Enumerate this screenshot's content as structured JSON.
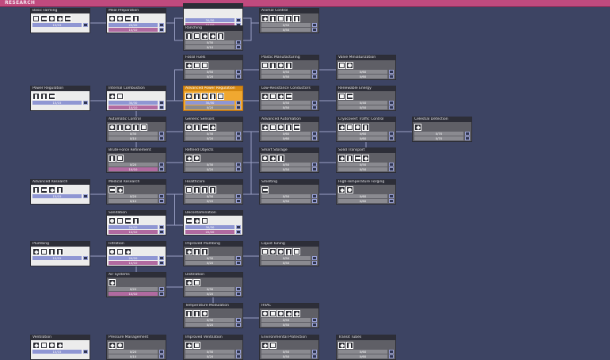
{
  "window": {
    "title": "RESEARCH"
  },
  "colors": {
    "background": "#3d4463",
    "header": "#c04a7e",
    "bar_primary": "#8f96d3",
    "bar_secondary": "#b16aa0",
    "active": "#f0a830"
  },
  "nodes": [
    {
      "name": "Basic Farming",
      "col": 0,
      "row": 0,
      "state": "done",
      "icons": [
        "plant",
        "planter",
        "oven",
        "cooker",
        "flag"
      ],
      "bars": [
        {
          "text": "15/15",
          "fill": 1
        }
      ]
    },
    {
      "name": "Meal Preparation",
      "col": 1,
      "row": 0,
      "state": "done",
      "icons": [
        "cooker",
        "grill",
        "fridge",
        "sink"
      ],
      "bars": [
        {
          "text": "20/20",
          "fill": 1
        },
        {
          "text": "10/10",
          "fill": 1
        }
      ]
    },
    {
      "name": "",
      "col": 2,
      "row": -0.15,
      "state": "done",
      "icons": [],
      "bars": [
        {
          "text": "30/30",
          "fill": 1
        },
        {
          "text": "10/10",
          "fill": 1
        }
      ]
    },
    {
      "name": "Animal Control",
      "col": 3,
      "row": 0,
      "state": "locked",
      "icons": [
        "trap",
        "feeder",
        "fishtrap",
        "incubator",
        "egg"
      ],
      "bars": [
        {
          "text": "0/50",
          "fill": 0
        },
        {
          "text": "0/50",
          "fill": 0
        }
      ]
    },
    {
      "name": "Ranching",
      "col": 2,
      "row": 0.55,
      "state": "locked",
      "icons": [
        "station",
        "drop",
        "barrier",
        "stable",
        "grooming"
      ],
      "bars": [
        {
          "text": "0/30",
          "fill": 0
        },
        {
          "text": "0/10",
          "fill": 0
        }
      ]
    },
    {
      "name": "Fossil Fuels",
      "col": 2,
      "row": 1.5,
      "state": "locked",
      "icons": [
        "generator",
        "pump",
        "refinery"
      ],
      "bars": [
        {
          "text": "0/50",
          "fill": 0
        },
        {
          "text": "0/20",
          "fill": 0
        }
      ]
    },
    {
      "name": "Plastic Manufacturing",
      "col": 3,
      "row": 1.5,
      "state": "locked",
      "icons": [
        "press",
        "loader",
        "pump",
        "vent"
      ],
      "bars": [
        {
          "text": "0/50",
          "fill": 0
        },
        {
          "text": "0/50",
          "fill": 0
        }
      ]
    },
    {
      "name": "Valve Miniaturization",
      "col": 4,
      "row": 1.5,
      "state": "locked",
      "icons": [
        "valve",
        "valve"
      ],
      "bars": [
        {
          "text": "0/60",
          "fill": 0
        },
        {
          "text": "0/60",
          "fill": 0
        }
      ]
    },
    {
      "name": "Power Regulation",
      "col": 0,
      "row": 2.5,
      "state": "done",
      "icons": [
        "battery",
        "transformer",
        "switch"
      ],
      "bars": [
        {
          "text": "15/15",
          "fill": 1
        }
      ]
    },
    {
      "name": "Internal Combustion",
      "col": 1,
      "row": 2.5,
      "state": "done",
      "icons": [
        "generator",
        "wire"
      ],
      "bars": [
        {
          "text": "30/30",
          "fill": 1
        },
        {
          "text": "10/10",
          "fill": 1
        }
      ]
    },
    {
      "name": "Advanced Power Regulation",
      "col": 2,
      "row": 2.5,
      "state": "active",
      "icons": [
        "transformer",
        "switch",
        "wire",
        "wire",
        "bridge"
      ],
      "bars": [
        {
          "text": "30/30",
          "fill": 1
        },
        {
          "text": "0/20",
          "fill": 0
        }
      ]
    },
    {
      "name": "Low-Resistance Conductors",
      "col": 3,
      "row": 2.5,
      "state": "locked",
      "icons": [
        "conductor",
        "wire",
        "battery",
        "joint"
      ],
      "bars": [
        {
          "text": "0/50",
          "fill": 0
        },
        {
          "text": "0/50",
          "fill": 0
        }
      ]
    },
    {
      "name": "Renewable Energy",
      "col": 4,
      "row": 2.5,
      "state": "locked",
      "icons": [
        "solar",
        "turbine"
      ],
      "bars": [
        {
          "text": "0/40",
          "fill": 0
        },
        {
          "text": "0/50",
          "fill": 0
        }
      ]
    },
    {
      "name": "Automatic Control",
      "col": 1,
      "row": 3.5,
      "state": "locked",
      "icons": [
        "sensor",
        "sensor",
        "gate",
        "gate",
        "motion"
      ],
      "bars": [
        {
          "text": "0/30",
          "fill": 0
        },
        {
          "text": "0/10",
          "fill": 0
        }
      ]
    },
    {
      "name": "Generic Sensors",
      "col": 2,
      "row": 3.5,
      "state": "locked",
      "icons": [
        "sensor",
        "sensor",
        "sensor",
        "sensor"
      ],
      "bars": [
        {
          "text": "0/30",
          "fill": 0
        },
        {
          "text": "0/20",
          "fill": 0
        }
      ]
    },
    {
      "name": "Advanced Automation",
      "col": 3,
      "row": 3.5,
      "state": "locked",
      "icons": [
        "gate",
        "gate",
        "gate",
        "gate",
        "gate"
      ],
      "bars": [
        {
          "text": "0/60",
          "fill": 0
        },
        {
          "text": "0/60",
          "fill": 0
        }
      ]
    },
    {
      "name": "Cryocovert Traffic Control",
      "col": 4,
      "row": 3.5,
      "state": "locked",
      "icons": [
        "rail",
        "rail",
        "rail",
        "rail"
      ],
      "bars": [
        {
          "text": "0/60",
          "fill": 0
        },
        {
          "text": "0/60",
          "fill": 0
        }
      ]
    },
    {
      "name": "Celestial Detection",
      "col": 5,
      "row": 3.5,
      "state": "locked",
      "icons": [
        "telescope"
      ],
      "bars": [
        {
          "text": "0/70",
          "fill": 0
        },
        {
          "text": "0/70",
          "fill": 0
        }
      ]
    },
    {
      "name": "Brute-Force Refinement",
      "col": 1,
      "row": 4.5,
      "state": "locked",
      "icons": [
        "crusher",
        "kiln"
      ],
      "bars": [
        {
          "text": "0/20",
          "fill": 0
        },
        {
          "text": "10/10",
          "fill": 1
        }
      ]
    },
    {
      "name": "Refined Objects",
      "col": 2,
      "row": 4.5,
      "state": "locked",
      "icons": [
        "door",
        "press"
      ],
      "bars": [
        {
          "text": "0/30",
          "fill": 0
        },
        {
          "text": "0/20",
          "fill": 0
        }
      ]
    },
    {
      "name": "Smart Storage",
      "col": 3,
      "row": 4.5,
      "state": "locked",
      "icons": [
        "locker",
        "bin",
        "shelf"
      ],
      "bars": [
        {
          "text": "0/50",
          "fill": 0
        },
        {
          "text": "0/50",
          "fill": 0
        }
      ]
    },
    {
      "name": "Solid Transport",
      "col": 4,
      "row": 4.5,
      "state": "locked",
      "icons": [
        "rail",
        "loader",
        "bridge",
        "sensor"
      ],
      "bars": [
        {
          "text": "0/50",
          "fill": 0
        },
        {
          "text": "0/50",
          "fill": 0
        }
      ]
    },
    {
      "name": "Advanced Research",
      "col": 0,
      "row": 5.5,
      "state": "done",
      "icons": [
        "station",
        "station",
        "station",
        "gear"
      ],
      "bars": [
        {
          "text": "15/15",
          "fill": 1
        }
      ]
    },
    {
      "name": "Medical Research",
      "col": 1,
      "row": 5.5,
      "state": "locked",
      "icons": [
        "bed",
        "cot"
      ],
      "bars": [
        {
          "text": "0/20",
          "fill": 0
        },
        {
          "text": "0/10",
          "fill": 0
        }
      ]
    },
    {
      "name": "Healthcare",
      "col": 2,
      "row": 5.5,
      "state": "locked",
      "icons": [
        "apothecary",
        "clinic",
        "cross",
        "pump"
      ],
      "bars": [
        {
          "text": "0/30",
          "fill": 0
        },
        {
          "text": "0/20",
          "fill": 0
        }
      ]
    },
    {
      "name": "Smelting",
      "col": 3,
      "row": 5.5,
      "state": "locked",
      "icons": [
        "refinery"
      ],
      "bars": [
        {
          "text": "0/50",
          "fill": 0
        },
        {
          "text": "0/50",
          "fill": 0
        }
      ]
    },
    {
      "name": "High-Temperature Forging",
      "col": 4,
      "row": 5.5,
      "state": "locked",
      "icons": [
        "kiln",
        "press"
      ],
      "bars": [
        {
          "text": "0/60",
          "fill": 0
        },
        {
          "text": "0/60",
          "fill": 0
        }
      ]
    },
    {
      "name": "Sanitation",
      "col": 1,
      "row": 6.5,
      "state": "done",
      "icons": [
        "toilet",
        "sink",
        "shower",
        "wash"
      ],
      "bars": [
        {
          "text": "20/20",
          "fill": 1
        },
        {
          "text": "10/10",
          "fill": 1
        }
      ]
    },
    {
      "name": "Decontamination",
      "col": 2,
      "row": 6.5,
      "state": "done",
      "icons": [
        "scrubber",
        "scrubber",
        "purifier"
      ],
      "bars": [
        {
          "text": "30/30",
          "fill": 1
        },
        {
          "text": "20/20",
          "fill": 1
        }
      ]
    },
    {
      "name": "Plumbing",
      "col": 0,
      "row": 7.5,
      "state": "done",
      "icons": [
        "pipe",
        "pump",
        "valve",
        "vent"
      ],
      "bars": [
        {
          "text": "15/15",
          "fill": 1
        }
      ]
    },
    {
      "name": "Filtration",
      "col": 1,
      "row": 7.5,
      "state": "done",
      "icons": [
        "filter",
        "pipe",
        "shutoff"
      ],
      "bars": [
        {
          "text": "20/20",
          "fill": 1
        },
        {
          "text": "10/10",
          "fill": 1
        }
      ]
    },
    {
      "name": "Improved Plumbing",
      "col": 2,
      "row": 7.5,
      "state": "locked",
      "icons": [
        "pipe",
        "bridge",
        "valve"
      ],
      "bars": [
        {
          "text": "0/30",
          "fill": 0
        },
        {
          "text": "0/20",
          "fill": 0
        }
      ]
    },
    {
      "name": "Liquid Tuning",
      "col": 3,
      "row": 7.5,
      "state": "locked",
      "icons": [
        "valve",
        "meter",
        "gate",
        "pump",
        "sensor"
      ],
      "bars": [
        {
          "text": "0/50",
          "fill": 0
        },
        {
          "text": "0/50",
          "fill": 0
        }
      ]
    },
    {
      "name": "Air Systems",
      "col": 1,
      "row": 8.5,
      "state": "locked",
      "icons": [
        "vent"
      ],
      "bars": [
        {
          "text": "0/20",
          "fill": 0
        },
        {
          "text": "10/10",
          "fill": 1
        }
      ]
    },
    {
      "name": "Distillation",
      "col": 2,
      "row": 8.5,
      "state": "locked",
      "icons": [
        "distiller",
        "tank"
      ],
      "bars": [
        {
          "text": "0/30",
          "fill": 0
        },
        {
          "text": "0/20",
          "fill": 0
        }
      ]
    },
    {
      "name": "Temperature Modulation",
      "col": 2,
      "row": 9.5,
      "state": "locked",
      "icons": [
        "coolant",
        "heater",
        "tempshift"
      ],
      "bars": [
        {
          "text": "0/30",
          "fill": 0
        },
        {
          "text": "0/20",
          "fill": 0
        }
      ]
    },
    {
      "name": "HVAC",
      "col": 3,
      "row": 9.5,
      "state": "locked",
      "icons": [
        "conditioner",
        "vent",
        "pump",
        "sensor",
        "valve"
      ],
      "bars": [
        {
          "text": "0/50",
          "fill": 0
        },
        {
          "text": "0/50",
          "fill": 0
        }
      ]
    },
    {
      "name": "Ventilation",
      "col": 0,
      "row": 10.5,
      "state": "done",
      "icons": [
        "vent",
        "pump",
        "pipe",
        "bridge"
      ],
      "bars": [
        {
          "text": "15/15",
          "fill": 1
        }
      ]
    },
    {
      "name": "Pressure Management",
      "col": 1,
      "row": 10.5,
      "state": "locked",
      "icons": [
        "pump",
        "valve"
      ],
      "bars": [
        {
          "text": "0/20",
          "fill": 0
        },
        {
          "text": "0/10",
          "fill": 0
        }
      ]
    },
    {
      "name": "Improved Ventilation",
      "col": 2,
      "row": 10.5,
      "state": "locked",
      "icons": [
        "vent",
        "pump"
      ],
      "bars": [
        {
          "text": "0/30",
          "fill": 0
        },
        {
          "text": "0/20",
          "fill": 0
        }
      ]
    },
    {
      "name": "Environmental Protection",
      "col": 3,
      "row": 10.5,
      "state": "locked",
      "icons": [
        "suit",
        "dock"
      ],
      "bars": [
        {
          "text": "0/50",
          "fill": 0
        },
        {
          "text": "0/50",
          "fill": 0
        }
      ]
    },
    {
      "name": "Transit Tubes",
      "col": 4,
      "row": 10.5,
      "state": "locked",
      "icons": [
        "tube",
        "access"
      ],
      "bars": [
        {
          "text": "0/60",
          "fill": 0
        },
        {
          "text": "0/60",
          "fill": 0
        }
      ]
    }
  ],
  "links": [
    [
      0,
      1
    ],
    [
      1,
      2
    ],
    [
      1,
      4
    ],
    [
      2,
      3
    ],
    [
      4,
      3
    ],
    [
      9,
      5
    ],
    [
      5,
      6
    ],
    [
      6,
      7
    ],
    [
      8,
      9
    ],
    [
      9,
      10
    ],
    [
      10,
      11
    ],
    [
      11,
      12
    ],
    [
      9,
      13
    ],
    [
      13,
      14
    ],
    [
      14,
      15
    ],
    [
      15,
      16
    ],
    [
      16,
      17
    ],
    [
      9,
      18
    ],
    [
      18,
      19
    ],
    [
      19,
      20
    ],
    [
      20,
      21
    ],
    [
      14,
      20
    ],
    [
      21,
      16
    ],
    [
      22,
      23
    ],
    [
      23,
      24
    ],
    [
      24,
      25
    ],
    [
      25,
      26
    ],
    [
      19,
      25
    ],
    [
      24,
      27
    ],
    [
      27,
      28
    ],
    [
      29,
      30
    ],
    [
      30,
      31
    ],
    [
      31,
      32
    ],
    [
      30,
      33
    ],
    [
      33,
      34
    ],
    [
      34,
      35
    ],
    [
      35,
      36
    ],
    [
      37,
      38
    ],
    [
      38,
      39
    ],
    [
      39,
      40
    ],
    [
      40,
      41
    ]
  ]
}
